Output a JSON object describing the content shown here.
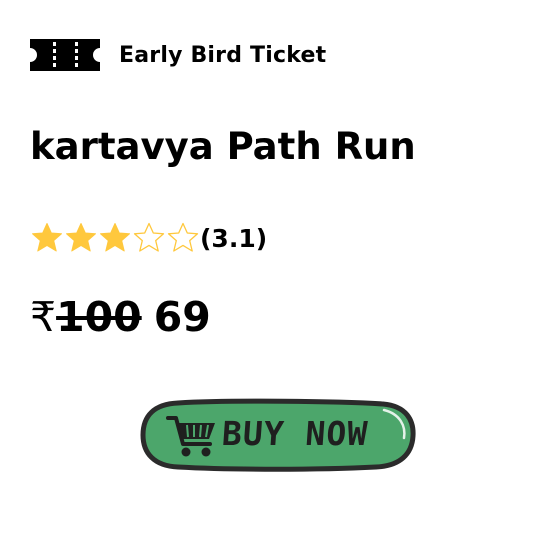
{
  "ticket": {
    "icon": "ticket-icon",
    "label": "Early Bird Ticket"
  },
  "event": {
    "title": "kartavya Path Run"
  },
  "rating": {
    "value": 3.1,
    "value_label": "(3.1)",
    "max_stars": 5,
    "filled_stars": 3,
    "star_color": "#FFC83D"
  },
  "price": {
    "currency": "₹",
    "original": "100",
    "discounted": "69"
  },
  "buy_button": {
    "label": "BUY NOW",
    "icon": "shopping-cart-icon",
    "background": "#4CA66B",
    "outline": "#2b2b2b"
  }
}
